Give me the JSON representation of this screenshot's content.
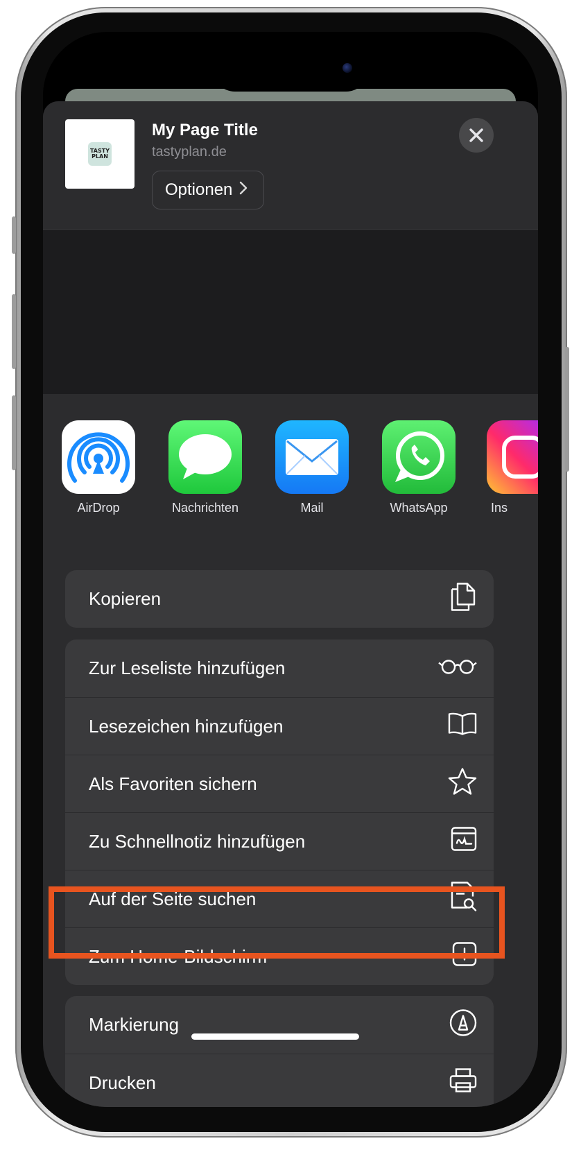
{
  "header": {
    "title": "My Page Title",
    "domain": "tastyplan.de",
    "options_label": "Optionen",
    "logo_line1": "TASTY",
    "logo_line2": "PLAN"
  },
  "apps": [
    {
      "label": "AirDrop",
      "icon": "airdrop-icon"
    },
    {
      "label": "Nachrichten",
      "icon": "messages-icon"
    },
    {
      "label": "Mail",
      "icon": "mail-icon"
    },
    {
      "label": "WhatsApp",
      "icon": "whatsapp-icon"
    },
    {
      "label": "Ins",
      "icon": "instagram-icon"
    }
  ],
  "actions": {
    "copy": "Kopieren",
    "reading_list": "Zur Leseliste hinzufügen",
    "bookmark": "Lesezeichen hinzufügen",
    "favorites": "Als Favoriten sichern",
    "quick_note": "Zu Schnellnotiz hinzufügen",
    "find": "Auf der Seite suchen",
    "home_screen": "Zum Home-Bildschirm",
    "markup": "Markierung",
    "print": "Drucken"
  },
  "colors": {
    "highlight": "#e8541f",
    "sheet": "#2c2c2e",
    "row": "#3a3a3c"
  }
}
